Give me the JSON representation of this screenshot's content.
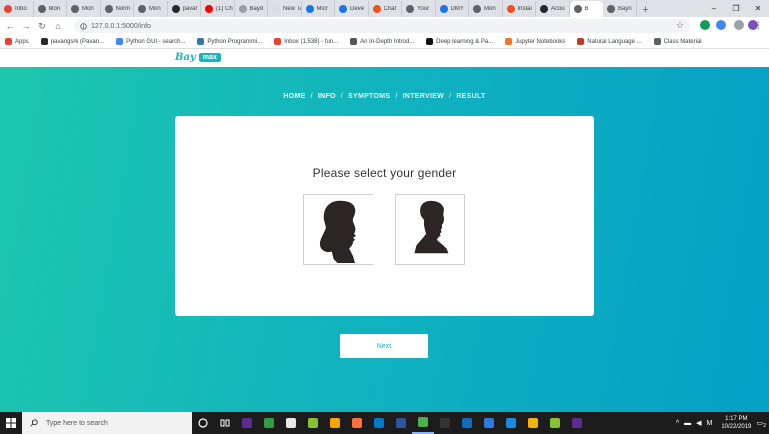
{
  "browser": {
    "tabs": [
      {
        "label": "Inbo",
        "color": "#ea4335"
      },
      {
        "label": "Mon",
        "color": "#5f6368"
      },
      {
        "label": "Mon",
        "color": "#5f6368"
      },
      {
        "label": "Norm",
        "color": "#5f6368"
      },
      {
        "label": "Mon",
        "color": "#5f6368"
      },
      {
        "label": "pavar",
        "color": "#24292e"
      },
      {
        "label": "(1) Ch",
        "color": "#ff0000"
      },
      {
        "label": "Bayd",
        "color": "#9aa0a6"
      },
      {
        "label": "New Tab",
        "color": "#dadce0"
      },
      {
        "label": "Micr",
        "color": "#1a73e8"
      },
      {
        "label": "Deve",
        "color": "#1a73e8"
      },
      {
        "label": "Chat",
        "color": "#f25022"
      },
      {
        "label": "Your",
        "color": "#5f6368"
      },
      {
        "label": "DMY",
        "color": "#1a73e8"
      },
      {
        "label": "Mon",
        "color": "#5f6368"
      },
      {
        "label": "Instal",
        "color": "#f25022"
      },
      {
        "label": "Acou",
        "color": "#24292e"
      },
      {
        "label": "B",
        "color": "#5f6368",
        "active": true
      },
      {
        "label": "Bayn",
        "color": "#5f6368"
      }
    ],
    "new_tab_symbol": "+",
    "window_controls": [
      "–",
      "❐",
      "✕"
    ],
    "url": "127.0.0.1:5000/info",
    "nav_symbols": {
      "back": "←",
      "forward": "→",
      "reload": "↻",
      "home": "⌂"
    },
    "star_symbol": "☆",
    "menu_symbol": "⋮",
    "extension_colors": [
      "#0f9d58",
      "#4285f4",
      "#9aa0a6",
      "#7b4fbd"
    ]
  },
  "bookmarks": [
    {
      "label": "Apps",
      "color": "#ea4335"
    },
    {
      "label": "pavangsrk (Pavan...",
      "color": "#24292e"
    },
    {
      "label": "Python GUI - search...",
      "color": "#4285f4"
    },
    {
      "label": "Python Programmi...",
      "color": "#3776ab"
    },
    {
      "label": "Inbox (1,538) - fun...",
      "color": "#ea4335"
    },
    {
      "label": "An In-Depth Introd...",
      "color": "#555555"
    },
    {
      "label": "Deep learning & Pa...",
      "color": "#111111"
    },
    {
      "label": "Jupyter Notebooks",
      "color": "#f37626"
    },
    {
      "label": "Natural Language ...",
      "color": "#c0392b"
    },
    {
      "label": "Class Material",
      "color": "#5f6368"
    }
  ],
  "site": {
    "logo_primary": "Bay",
    "logo_secondary": "max"
  },
  "steps": [
    {
      "label": "HOME",
      "current": true
    },
    {
      "label": "INFO",
      "current": true
    },
    {
      "label": "SYMPTOMS",
      "current": false
    },
    {
      "label": "INTERVIEW",
      "current": false
    },
    {
      "label": "RESULT",
      "current": false
    }
  ],
  "step_separator": "/",
  "question": "Please select your gender",
  "gender_options": [
    "female",
    "male"
  ],
  "next_label": "Next",
  "taskbar": {
    "search_placeholder": "Type here to search",
    "apps": [
      "#5c2d91",
      "#2ea043",
      "#e8e8e8",
      "#86c232",
      "#f7a600",
      "#ff7139",
      "#007acc",
      "#2b579a",
      "#4caf50",
      "#333333",
      "#0f6cbd",
      "#2c7be5",
      "#1e88e5",
      "#f4b400",
      "#86c232",
      "#5c2d91"
    ],
    "clock_time": "1:17 PM",
    "clock_date": "10/22/2019",
    "notification_count": "2"
  }
}
